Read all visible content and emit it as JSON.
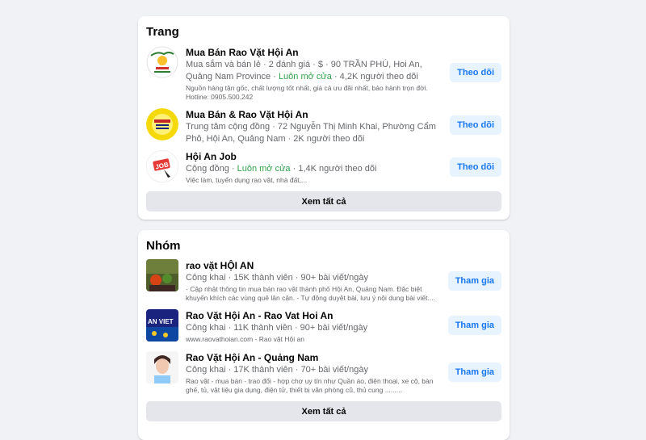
{
  "pages_section": {
    "title": "Trang",
    "items": [
      {
        "name": "Mua Bán Rao Vặt Hội An",
        "meta_prefix": "Mua sắm và bán lẻ · 2 đánh giá · $ · 90 TRẦN PHÚ, Hoi An, Quảng Nam Province · ",
        "status": "Luôn mở cửa",
        "meta_suffix": " · 4,2K người theo dõi",
        "description": "Nguồn hàng tận gốc, chất lượng tốt nhất, giá cả ưu đãi nhất, bảo hành trọn đời. Hotline: 0905.500.242",
        "button": "Theo dõi"
      },
      {
        "name": "Mua Bán & Rao Vặt Hội An",
        "meta": "Trung tâm cộng đồng · 72 Nguyễn Thị Minh Khai, Phường Cẩm Phô, Hội An, Quảng Nam · 2K người theo dõi",
        "button": "Theo dõi"
      },
      {
        "name": "Hội An Job",
        "meta_prefix": "Cộng đồng · ",
        "status": "Luôn mở cửa",
        "meta_suffix": " · 1,4K người theo dõi",
        "description": "Việc làm, tuyển dụng rao vặt, nhà đất,...",
        "button": "Theo dõi",
        "avatar_text": "JOB"
      }
    ],
    "see_all": "Xem tất cả"
  },
  "groups_section": {
    "title": "Nhóm",
    "items": [
      {
        "name": "rao vặt HỘI AN",
        "meta": "Công khai · 15K thành viên · 90+ bài viết/ngày",
        "description": "- Cập nhật thông tin mua bán rao vặt thành phố Hội An, Quảng Nam. Đặc biệt khuyến khích các vùng quê lân cận. - Tự động duyệt bài, lưu ý nội dung bài viết....",
        "button": "Tham gia"
      },
      {
        "name": "Rao Vặt Hội An - Rao Vat Hoi An",
        "meta": "Công khai · 11K thành viên · 90+ bài viết/ngày",
        "description": "www.raovathoian.com - Rao vặt Hội an",
        "button": "Tham gia",
        "avatar_text": "AN VIET"
      },
      {
        "name": "Rao Vặt Hội An - Quảng Nam",
        "meta": "Công khai · 17K thành viên · 70+ bài viết/ngày",
        "description": "Rao vặt - mua bán - trao đổi - hợp chợ uy tín như Quần áo, điện thoại, xe cộ, bàn ghế, tủ, vật liệu gia dụng, điện tử, thiết bị văn phòng cũ, thủ cung .........",
        "button": "Tham gia"
      }
    ],
    "see_all": "Xem tất cả"
  },
  "colors": {
    "background": "#f0f2f5",
    "card": "#ffffff",
    "button_bg": "#e7f3ff",
    "button_text": "#1877f2",
    "open_status": "#31a24c",
    "secondary_text": "#65676b"
  }
}
